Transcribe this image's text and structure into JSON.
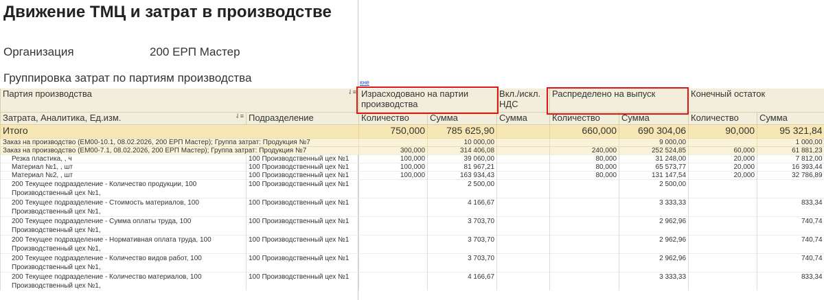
{
  "report": {
    "title": "Движение ТМЦ и затрат в производстве",
    "org_label": "Организация",
    "org_value": "200 ЕРП Мастер",
    "grouping": "Группировка затрат по партиям производства",
    "link_text": "кне"
  },
  "headers": {
    "top": [
      "Партия производства",
      "Израсходовано на партии производства",
      "Вкл./искл. НДС",
      "Распределено на выпуск",
      "Конечный остаток"
    ],
    "sub": [
      "Затрата, Аналитика, Ед.изм.",
      "Подразделение",
      "Количество",
      "Сумма",
      "Сумма",
      "Количество",
      "Сумма",
      "Количество",
      "Сумма"
    ]
  },
  "total": {
    "label": "Итого",
    "values": [
      "750,000",
      "785 625,90",
      "",
      "660,000",
      "690 304,06",
      "90,000",
      "95 321,84"
    ]
  },
  "groups": [
    {
      "label": "Заказ на производство (ЕМ00-10.1, 08.02.2026, 200 ЕРП Мастер); Группа затрат: Продукция №7",
      "values": [
        "",
        "10 000,00",
        "",
        "",
        "9 000,00",
        "",
        "1 000,00"
      ]
    },
    {
      "label": "Заказ на производство (ЕМ00-7.1, 08.02.2026, 200 ЕРП Мастер); Группа затрат: Продукция №7",
      "values": [
        "300,000",
        "314 406,08",
        "",
        "240,000",
        "252 524,85",
        "60,000",
        "61 881,23"
      ]
    }
  ],
  "rows": [
    {
      "name": "Резка пластика, , ч",
      "dept": "100 Производственный цех №1",
      "values": [
        "100,000",
        "39 060,00",
        "",
        "80,000",
        "31 248,00",
        "20,000",
        "7 812,00"
      ]
    },
    {
      "name": "Материал №1, , шт",
      "dept": "100 Производственный цех №1",
      "values": [
        "100,000",
        "81 967,21",
        "",
        "80,000",
        "65 573,77",
        "20,000",
        "16 393,44"
      ]
    },
    {
      "name": "Материал №2, , шт",
      "dept": "100 Производственный цех №1",
      "values": [
        "100,000",
        "163 934,43",
        "",
        "80,000",
        "131 147,54",
        "20,000",
        "32 786,89"
      ]
    }
  ],
  "rows2": [
    {
      "name": "200 Текущее подразделение - Количество продукции, 100 Производственный цех №1,",
      "dept": "100 Производственный цех №1",
      "values": [
        "",
        "2 500,00",
        "",
        "",
        "2 500,00",
        "",
        ""
      ]
    },
    {
      "name": "200 Текущее подразделение - Стоимость материалов, 100 Производственный цех №1,",
      "dept": "100 Производственный цех №1",
      "values": [
        "",
        "4 166,67",
        "",
        "",
        "3 333,33",
        "",
        "833,34"
      ]
    },
    {
      "name": "200 Текущее подразделение - Сумма оплаты труда, 100 Производственный цех №1,",
      "dept": "100 Производственный цех №1",
      "values": [
        "",
        "3 703,70",
        "",
        "",
        "2 962,96",
        "",
        "740,74"
      ]
    },
    {
      "name": "200 Текущее подразделение - Нормативная оплата труда, 100 Производственный цех №1,",
      "dept": "100 Производственный цех №1",
      "values": [
        "",
        "3 703,70",
        "",
        "",
        "2 962,96",
        "",
        "740,74"
      ]
    },
    {
      "name": "200 Текущее подразделение - Количество видов работ, 100 Производственный цех №1,",
      "dept": "100 Производственный цех №1",
      "values": [
        "",
        "3 703,70",
        "",
        "",
        "2 962,96",
        "",
        "740,74"
      ]
    },
    {
      "name": "200 Текущее подразделение - Количество материалов, 100 Производственный цех №1,",
      "dept": "100 Производственный цех №1",
      "values": [
        "",
        "4 166,67",
        "",
        "",
        "3 333,33",
        "",
        "833,34"
      ]
    }
  ],
  "colors": {
    "header_bg": "#f2eedb",
    "total_bg": "#f7e7b5",
    "group_bg": "#fbf3d9",
    "highlight": "#e01616"
  }
}
